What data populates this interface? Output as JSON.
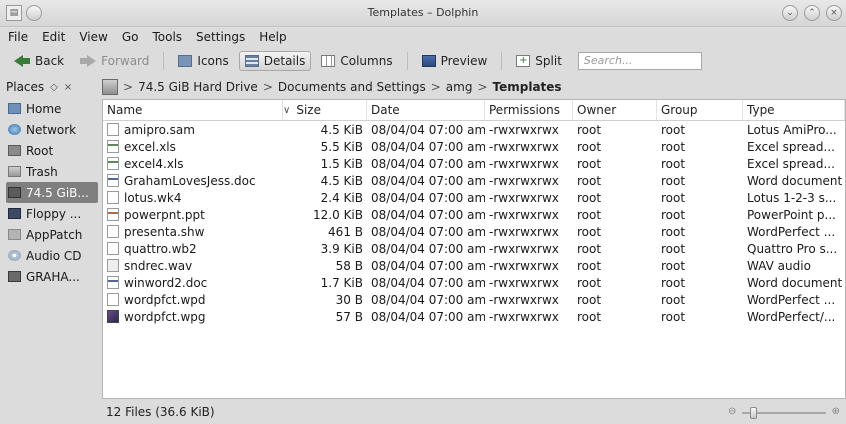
{
  "window": {
    "title": "Templates – Dolphin"
  },
  "menu": [
    {
      "label": "File"
    },
    {
      "label": "Edit"
    },
    {
      "label": "View"
    },
    {
      "label": "Go"
    },
    {
      "label": "Tools"
    },
    {
      "label": "Settings"
    },
    {
      "label": "Help"
    }
  ],
  "toolbar": {
    "back": "Back",
    "forward": "Forward",
    "icons": "Icons",
    "details": "Details",
    "columns": "Columns",
    "preview": "Preview",
    "split": "Split",
    "search_placeholder": "Search..."
  },
  "places": {
    "title": "Places",
    "items": [
      {
        "label": "Home",
        "icon": "home-icon"
      },
      {
        "label": "Network",
        "icon": "network-icon"
      },
      {
        "label": "Root",
        "icon": "root-folder-icon"
      },
      {
        "label": "Trash",
        "icon": "trash-icon"
      },
      {
        "label": "74.5 GiB...",
        "icon": "hard-drive-icon",
        "selected": true
      },
      {
        "label": "Floppy ...",
        "icon": "floppy-icon"
      },
      {
        "label": "AppPatch",
        "icon": "folder-icon"
      },
      {
        "label": "Audio CD",
        "icon": "cd-icon"
      },
      {
        "label": "GRAHA...",
        "icon": "drive-icon"
      }
    ]
  },
  "breadcrumb": {
    "items": [
      "74.5 GiB Hard Drive",
      "Documents and Settings",
      "amg"
    ],
    "current": "Templates",
    "separator": ">"
  },
  "table": {
    "columns": {
      "name": "Name",
      "size": "Size",
      "date": "Date",
      "permissions": "Permissions",
      "owner": "Owner",
      "group": "Group",
      "type": "Type"
    },
    "rows": [
      {
        "name": "amipro.sam",
        "size": "4.5 KiB",
        "date": "08/04/04 07:00 am",
        "perm": "-rwxrwxrwx",
        "owner": "root",
        "group": "root",
        "type": "Lotus AmiPro...",
        "icon": "document-icon"
      },
      {
        "name": "excel.xls",
        "size": "5.5 KiB",
        "date": "08/04/04 07:00 am",
        "perm": "-rwxrwxrwx",
        "owner": "root",
        "group": "root",
        "type": "Excel spread...",
        "icon": "spreadsheet-icon"
      },
      {
        "name": "excel4.xls",
        "size": "1.5 KiB",
        "date": "08/04/04 07:00 am",
        "perm": "-rwxrwxrwx",
        "owner": "root",
        "group": "root",
        "type": "Excel spread...",
        "icon": "spreadsheet-icon"
      },
      {
        "name": "GrahamLovesJess.doc",
        "size": "4.5 KiB",
        "date": "08/04/04 07:00 am",
        "perm": "-rwxrwxrwx",
        "owner": "root",
        "group": "root",
        "type": "Word document",
        "icon": "word-document-icon"
      },
      {
        "name": "lotus.wk4",
        "size": "2.4 KiB",
        "date": "08/04/04 07:00 am",
        "perm": "-rwxrwxrwx",
        "owner": "root",
        "group": "root",
        "type": "Lotus 1-2-3 s...",
        "icon": "document-icon"
      },
      {
        "name": "powerpnt.ppt",
        "size": "12.0 KiB",
        "date": "08/04/04 07:00 am",
        "perm": "-rwxrwxrwx",
        "owner": "root",
        "group": "root",
        "type": "PowerPoint p...",
        "icon": "presentation-icon"
      },
      {
        "name": "presenta.shw",
        "size": "461 B",
        "date": "08/04/04 07:00 am",
        "perm": "-rwxrwxrwx",
        "owner": "root",
        "group": "root",
        "type": "WordPerfect ...",
        "icon": "document-icon"
      },
      {
        "name": "quattro.wb2",
        "size": "3.9 KiB",
        "date": "08/04/04 07:00 am",
        "perm": "-rwxrwxrwx",
        "owner": "root",
        "group": "root",
        "type": "Quattro Pro s...",
        "icon": "document-icon"
      },
      {
        "name": "sndrec.wav",
        "size": "58 B",
        "date": "08/04/04 07:00 am",
        "perm": "-rwxrwxrwx",
        "owner": "root",
        "group": "root",
        "type": "WAV audio",
        "icon": "audio-file-icon"
      },
      {
        "name": "winword2.doc",
        "size": "1.7 KiB",
        "date": "08/04/04 07:00 am",
        "perm": "-rwxrwxrwx",
        "owner": "root",
        "group": "root",
        "type": "Word document",
        "icon": "word-document-icon"
      },
      {
        "name": "wordpfct.wpd",
        "size": "30 B",
        "date": "08/04/04 07:00 am",
        "perm": "-rwxrwxrwx",
        "owner": "root",
        "group": "root",
        "type": "WordPerfect ...",
        "icon": "document-icon"
      },
      {
        "name": "wordpfct.wpg",
        "size": "57 B",
        "date": "08/04/04 07:00 am",
        "perm": "-rwxrwxrwx",
        "owner": "root",
        "group": "root",
        "type": "WordPerfect/...",
        "icon": "image-file-icon"
      }
    ]
  },
  "status": {
    "text": "12 Files (36.6 KiB)"
  }
}
